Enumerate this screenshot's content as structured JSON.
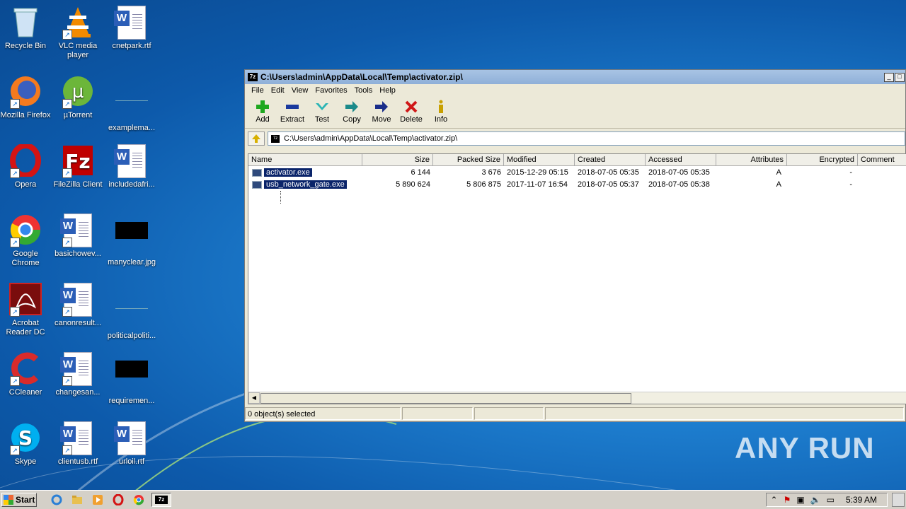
{
  "desktop": {
    "icons": [
      {
        "label": "Recycle Bin",
        "icon": "recycle-bin-icon"
      },
      {
        "label": "VLC media player",
        "icon": "vlc-icon"
      },
      {
        "label": "cnetpark.rtf",
        "icon": "word-doc-icon"
      },
      {
        "label": "Mozilla Firefox",
        "icon": "firefox-icon"
      },
      {
        "label": "µTorrent",
        "icon": "utorrent-icon"
      },
      {
        "label": "examplema...",
        "icon": "file-icon"
      },
      {
        "label": "Opera",
        "icon": "opera-icon"
      },
      {
        "label": "FileZilla Client",
        "icon": "filezilla-icon"
      },
      {
        "label": "includedafri...",
        "icon": "word-doc-icon"
      },
      {
        "label": "Google Chrome",
        "icon": "chrome-icon"
      },
      {
        "label": "basichowev...",
        "icon": "word-doc-icon"
      },
      {
        "label": "manyclear.jpg",
        "icon": "image-icon"
      },
      {
        "label": "Acrobat Reader DC",
        "icon": "acrobat-icon"
      },
      {
        "label": "canonresult...",
        "icon": "word-doc-icon"
      },
      {
        "label": "politicalpoliti...",
        "icon": "file-icon"
      },
      {
        "label": "CCleaner",
        "icon": "ccleaner-icon"
      },
      {
        "label": "changesan...",
        "icon": "word-doc-icon"
      },
      {
        "label": "requiremen...",
        "icon": "image-icon"
      },
      {
        "label": "Skype",
        "icon": "skype-icon"
      },
      {
        "label": "clientusb.rtf",
        "icon": "word-doc-icon"
      },
      {
        "label": "urloil.rtf",
        "icon": "word-doc-icon"
      }
    ]
  },
  "window": {
    "app_icon_text": "7z",
    "title": "C:\\Users\\admin\\AppData\\Local\\Temp\\activator.zip\\",
    "menu": [
      "File",
      "Edit",
      "View",
      "Favorites",
      "Tools",
      "Help"
    ],
    "toolbar": [
      {
        "label": "Add",
        "icon": "add-icon",
        "color": "#1fa81f"
      },
      {
        "label": "Extract",
        "icon": "extract-icon",
        "color": "#1a3a9e"
      },
      {
        "label": "Test",
        "icon": "test-icon",
        "color": "#2bb5b5"
      },
      {
        "label": "Copy",
        "icon": "copy-icon",
        "color": "#1b8a8a"
      },
      {
        "label": "Move",
        "icon": "move-icon",
        "color": "#1a2e8a"
      },
      {
        "label": "Delete",
        "icon": "delete-icon",
        "color": "#d01818"
      },
      {
        "label": "Info",
        "icon": "info-icon",
        "color": "#c8a000"
      }
    ],
    "address": "C:\\Users\\admin\\AppData\\Local\\Temp\\activator.zip\\",
    "columns": [
      "Name",
      "Size",
      "Packed Size",
      "Modified",
      "Created",
      "Accessed",
      "Attributes",
      "Encrypted",
      "Comment"
    ],
    "files": [
      {
        "name": "activator.exe",
        "size": "6 144",
        "packed": "3 676",
        "modified": "2015-12-29 05:15",
        "created": "2018-07-05 05:35",
        "accessed": "2018-07-05 05:35",
        "attributes": "A",
        "encrypted": "-",
        "comment": ""
      },
      {
        "name": "usb_network_gate.exe",
        "size": "5 890 624",
        "packed": "5 806 875",
        "modified": "2017-11-07 16:54",
        "created": "2018-07-05 05:37",
        "accessed": "2018-07-05 05:38",
        "attributes": "A",
        "encrypted": "-",
        "comment": ""
      }
    ],
    "status": "0 object(s) selected"
  },
  "watermark": "ANY RUN",
  "taskbar": {
    "start_label": "Start",
    "clock": "5:39 AM",
    "active_task_label": "7z"
  }
}
